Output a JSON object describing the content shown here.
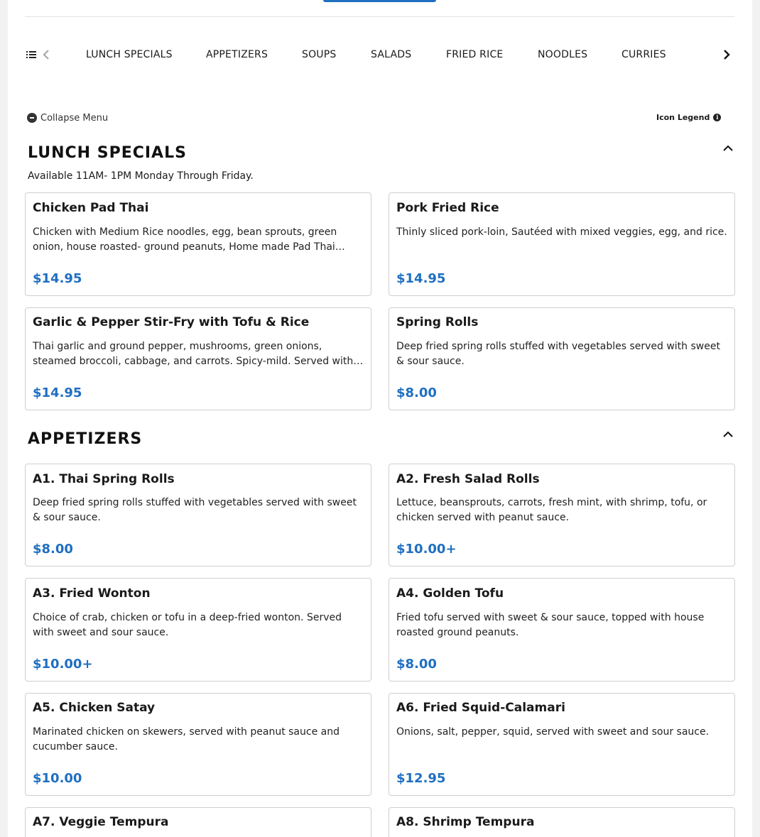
{
  "categories": [
    "LUNCH SPECIALS",
    "APPETIZERS",
    "SOUPS",
    "SALADS",
    "FRIED RICE",
    "NOODLES",
    "CURRIES"
  ],
  "collapse_label": "Collapse Menu",
  "legend_label": "Icon Legend",
  "sections": [
    {
      "title": "LUNCH SPECIALS",
      "note": "Available 11AM- 1PM Monday Through Friday.",
      "items": [
        {
          "name": "Chicken Pad Thai",
          "desc": "Chicken with Medium Rice noodles, egg, bean sprouts, green onion, house roasted- ground peanuts, Home made Pad Thai sauce.",
          "price": "$14.95"
        },
        {
          "name": "Pork Fried Rice",
          "desc": "Thinly sliced pork-loin, Sautéed with mixed veggies, egg, and rice.",
          "price": "$14.95"
        },
        {
          "name": "Garlic & Pepper Stir-Fry with Tofu & Rice",
          "desc": "Thai garlic and ground pepper, mushrooms, green onions, steamed broccoli, cabbage, and carrots. Spicy-mild. Served with rice.",
          "price": "$14.95"
        },
        {
          "name": "Spring Rolls",
          "desc": "Deep fried spring rolls stuffed with vegetables served with sweet & sour sauce.",
          "price": "$8.00"
        }
      ]
    },
    {
      "title": "APPETIZERS",
      "items": [
        {
          "name": "A1. Thai Spring Rolls",
          "desc": "Deep fried spring rolls stuffed with vegetables served with sweet & sour sauce.",
          "price": "$8.00"
        },
        {
          "name": "A2. Fresh Salad Rolls",
          "desc": "Lettuce, beansprouts, carrots, fresh mint, with shrimp, tofu, or chicken served with peanut sauce.",
          "price": "$10.00+"
        },
        {
          "name": "A3. Fried Wonton",
          "desc": "Choice of crab, chicken or tofu in a deep-fried wonton. Served with sweet and sour sauce.",
          "price": "$10.00+"
        },
        {
          "name": "A4. Golden Tofu",
          "desc": "Fried tofu served with sweet & sour sauce, topped with house roasted ground peanuts.",
          "price": "$8.00"
        },
        {
          "name": "A5. Chicken Satay",
          "desc": "Marinated chicken on skewers, served with peanut sauce and cucumber sauce.",
          "price": "$10.00"
        },
        {
          "name": "A6. Fried Squid-Calamari",
          "desc": "Onions, salt, pepper, squid, served with sweet and sour sauce.",
          "price": "$12.95"
        },
        {
          "name": "A7. Veggie Tempura",
          "desc": "",
          "price": ""
        },
        {
          "name": "A8. Shrimp Tempura",
          "desc": "",
          "price": ""
        }
      ]
    }
  ]
}
